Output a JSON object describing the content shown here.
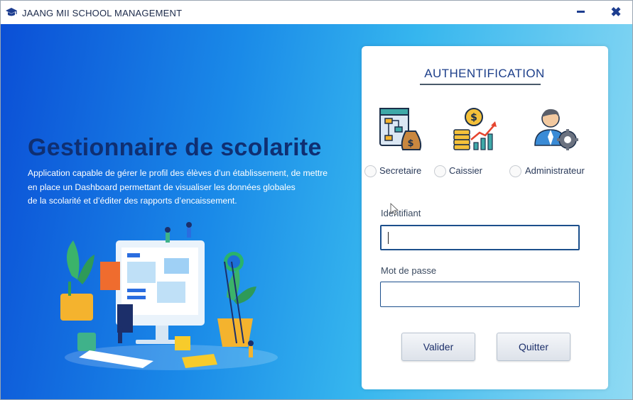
{
  "window": {
    "title": "JAANG MII SCHOOL MANAGEMENT",
    "app_icon": "graduation-cap-icon",
    "minimize_icon": "minimize-icon",
    "close_icon": "close-icon",
    "close_glyph": "✖"
  },
  "hero": {
    "headline": "Gestionnaire de scolarite",
    "description_lines": [
      "Application capable de gérer le profil des élèves d’un établissement, de mettre",
      "en place un Dashboard permettant de visualiser les données globales",
      "de la scolarité et d’éditer des rapports d’encaissement."
    ],
    "illustration": "school-management-illustration"
  },
  "auth": {
    "title": "AUTHENTIFICATION",
    "roles": [
      {
        "label": "Secretaire",
        "icon": "secretary-workflow-icon",
        "selected": false
      },
      {
        "label": "Caissier",
        "icon": "cashier-coins-chart-icon",
        "selected": false
      },
      {
        "label": "Administrateur",
        "icon": "admin-user-gear-icon",
        "selected": false
      }
    ],
    "username_label": "Identifiant",
    "username_value": "",
    "password_label": "Mot de passe",
    "password_value": "",
    "submit_label": "Valider",
    "quit_label": "Quitter"
  },
  "colors": {
    "gradient_start": "#0b4fd6",
    "gradient_end": "#8fdaf3",
    "headline": "#0f2f72",
    "field_border": "#1c4f8c"
  }
}
